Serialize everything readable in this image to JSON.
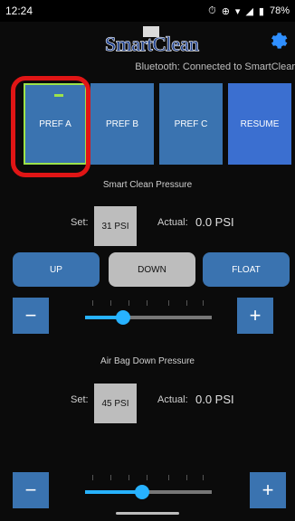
{
  "status": {
    "time": "12:24",
    "battery": "78%"
  },
  "header": {
    "logo_text": "SmartClean"
  },
  "bluetooth_status": "Bluetooth: Connected to SmartClear",
  "prefs": {
    "a": "PREF A",
    "b": "PREF B",
    "c": "PREF C",
    "resume": "RESUME"
  },
  "smart_clean": {
    "title": "Smart Clean Pressure",
    "set_label": "Set:",
    "set_value": "31 PSI",
    "actual_label": "Actual:",
    "actual_value": "0.0 PSI",
    "slider_fraction": 0.3
  },
  "controls": {
    "up": "UP",
    "down": "DOWN",
    "float": "FLOAT"
  },
  "air_bag": {
    "title": "Air Bag Down Pressure",
    "set_label": "Set:",
    "set_value": "45 PSI",
    "actual_label": "Actual:",
    "actual_value": "0.0 PSI",
    "slider_fraction": 0.45
  },
  "stepper": {
    "minus": "−",
    "plus": "+"
  },
  "colors": {
    "accent": "#3a73b0",
    "active_border": "#9de34a",
    "highlight": "#e01515",
    "slider": "#27b2ff"
  }
}
